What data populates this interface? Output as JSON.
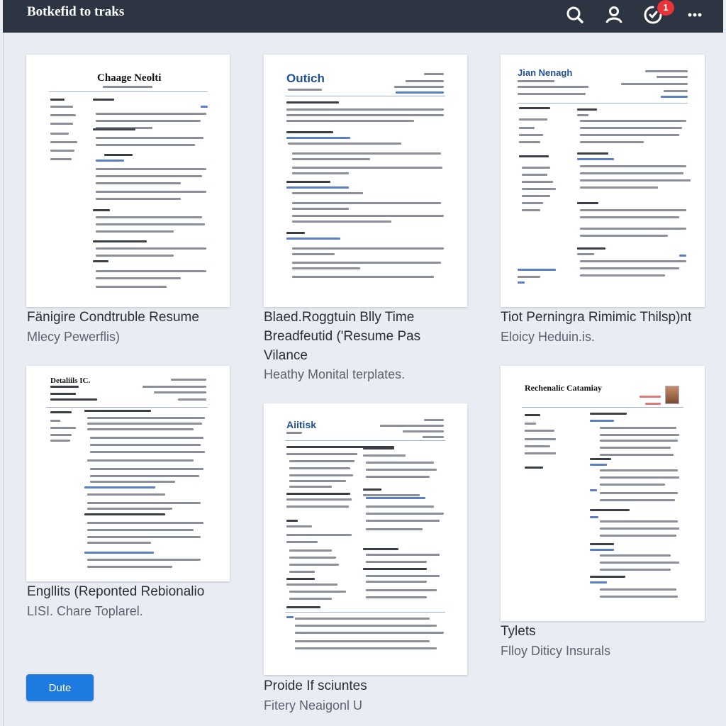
{
  "app": {
    "title": "Botkefid to traks",
    "notification_count": "1"
  },
  "icons": [
    "search-icon",
    "user-icon",
    "notification-icon",
    "more-icon"
  ],
  "cards": [
    {
      "title": "Fänigire Condtruble Resume",
      "subtitle": "Mlecy Pewerflis)",
      "doc_name": "Chaage Neolti"
    },
    {
      "title_line1": "Blaed.Roggtuin Blly Time",
      "title_line2": "Breadfeutid ('Resume Pas",
      "title_line3": "Vilance",
      "subtitle": "Heathy Monital terplates.",
      "doc_name": "Outich"
    },
    {
      "title": "Tiot Perningra Rimimic Thilsp)nt",
      "subtitle": "Eloicy Heduin.is.",
      "doc_name": "Jian Nenagh"
    },
    {
      "title": "Engllits (Reponted Rebionalio",
      "subtitle": "LISI. Chare Toplarel.",
      "doc_name": "Detaliils IC."
    },
    {
      "title": "Proide If sciuntes",
      "subtitle": "Fitery Neaigonl U",
      "doc_name": "Aiitisk"
    },
    {
      "title": "Tylets",
      "subtitle": "Flloy Diticy Insurals",
      "doc_name": "Rechenalic Catamiay"
    }
  ],
  "done_button": "Dute",
  "colors": {
    "topbar": "#2d3442",
    "accent": "#1d7be0",
    "badge": "#e8333a",
    "heading_blue": "#1f4e96"
  }
}
